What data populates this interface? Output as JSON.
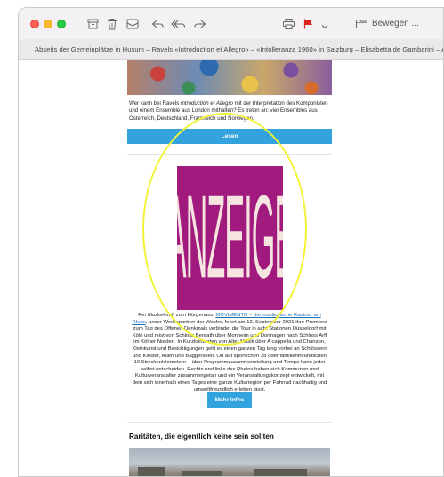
{
  "toolbar": {
    "move_label": "Bewegen ...",
    "icons": [
      "archive-icon",
      "trash-icon",
      "junk-icon",
      "reply-icon",
      "reply-all-icon",
      "forward-icon",
      "print-icon",
      "flag-icon",
      "move-folder-icon"
    ]
  },
  "subject": "Abseits der Gemeinplätze in Husum – Ravels «Introduction et Allegro» – «Intolleranza 1960» in Salzburg – Elisabetta de Gambarini – Alle",
  "article": {
    "intro_part1": "Wer kann bei Ravels ",
    "intro_title": "Introduction et Allegro",
    "intro_part2": " mit der Interpretation des Komponisten und einem Ensemble aus London mithalten? Es treten an: vier Ensembles aus Österreich, Deutschland, Frankreich und Norwegen.",
    "read_button": "Lesen"
  },
  "ad": {
    "label": "ANZEIGE",
    "caption_before": "Per Muskelkraft zum Hörgenuss: ",
    "caption_link": "MOVIMENTO – die musikalische Radtour am Rhein",
    "caption_after": ", unser Werbepartner der Woche, feiert am 12. September 2021 ihre Premiere zum Tag des Offenen Denkmals verbindet die Tour in acht Stationen Düsseldorf mit Köln und reist von Schloss Benrath über Monheim und Dormagen nach Schloss Arff im Kölner Norden. In Kurzkonzerten von Alter Musik über A cappella und Chanson, Kleinkunst und Besichtigungen geht es einen ganzen Tag lang vorbei an Schlössern und Kloster, Auen und Baggerseen. Ob auf sportlichen 28 oder familienfreundlichen 10 Streckenkilometern – über Programmzusammenstellung und Tempo kann jeder selbst entscheiden. Rechts und links des Rheins haben sich Kommunen und Kulturveranstalter zusammengetan und ein Veranstaltungskonzept entwickelt, mit dem sich innerhalb eines Tages eine ganze Kulturregion per Fahrrad nachhaltig und umweltfreundlich erleben lässt.",
    "more_button": "Mehr Infos"
  },
  "next_section": {
    "title": "Raritäten, die eigentlich keine sein sollten"
  },
  "colors": {
    "ad_background": "#a01b7d",
    "ad_text": "#f6e4e0",
    "button_blue": "#32a3dc",
    "highlight": "#f2f23a"
  }
}
